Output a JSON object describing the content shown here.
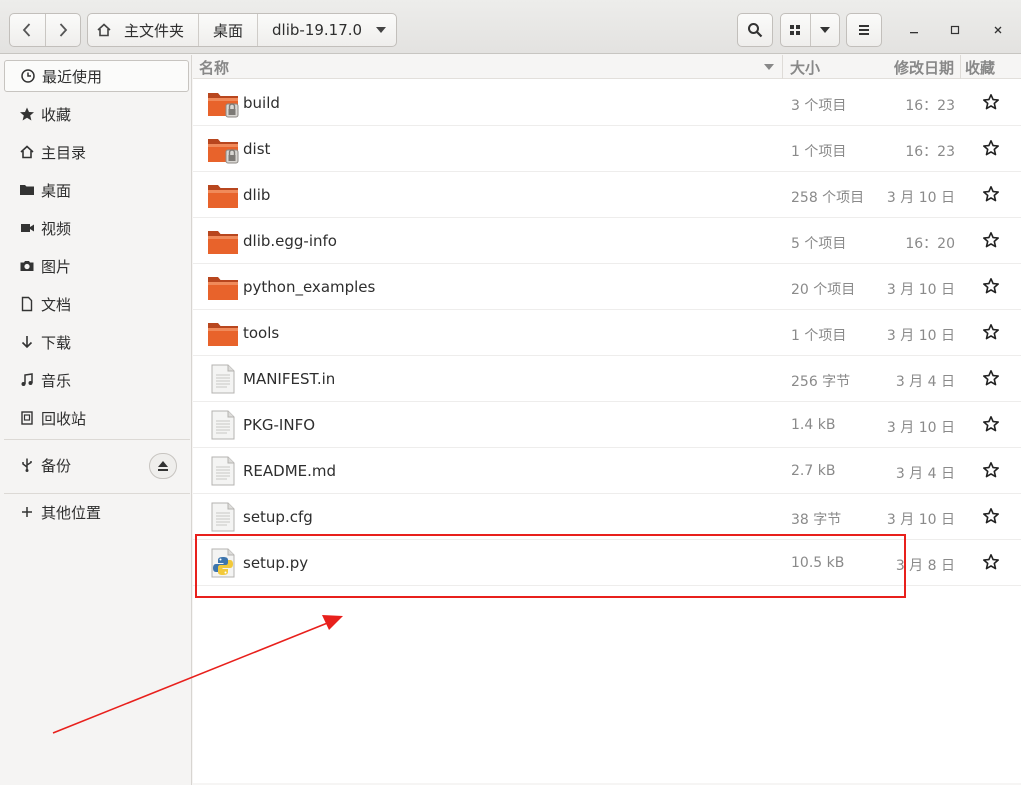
{
  "header": {
    "path": [
      "主文件夹",
      "桌面",
      "dlib-19.17.0"
    ]
  },
  "sidebar": {
    "items": [
      {
        "label": "最近使用",
        "icon": "clock-icon"
      },
      {
        "label": "收藏",
        "icon": "star-icon"
      },
      {
        "label": "主目录",
        "icon": "home-icon"
      },
      {
        "label": "桌面",
        "icon": "folder-icon"
      },
      {
        "label": "视频",
        "icon": "video-icon"
      },
      {
        "label": "图片",
        "icon": "camera-icon"
      },
      {
        "label": "文档",
        "icon": "document-icon"
      },
      {
        "label": "下载",
        "icon": "download-icon"
      },
      {
        "label": "音乐",
        "icon": "music-icon"
      },
      {
        "label": "回收站",
        "icon": "trash-icon"
      },
      {
        "label": "备份",
        "icon": "usb-icon"
      },
      {
        "label": "其他位置",
        "icon": "plus-icon"
      }
    ]
  },
  "columns": {
    "name": "名称",
    "size": "大小",
    "modified": "修改日期",
    "starred": "收藏"
  },
  "files": [
    {
      "name": "build",
      "size": "3 个项目",
      "date": "16：23",
      "type": "folder-locked"
    },
    {
      "name": "dist",
      "size": "1 个项目",
      "date": "16：23",
      "type": "folder-locked"
    },
    {
      "name": "dlib",
      "size": "258 个项目",
      "date": "3 月 10 日",
      "type": "folder"
    },
    {
      "name": "dlib.egg-info",
      "size": "5 个项目",
      "date": "16：20",
      "type": "folder"
    },
    {
      "name": "python_examples",
      "size": "20 个项目",
      "date": "3 月 10 日",
      "type": "folder"
    },
    {
      "name": "tools",
      "size": "1 个项目",
      "date": "3 月 10 日",
      "type": "folder"
    },
    {
      "name": "MANIFEST.in",
      "size": "256 字节",
      "date": "3 月 4 日",
      "type": "text"
    },
    {
      "name": "PKG-INFO",
      "size": "1.4 kB",
      "date": "3 月 10 日",
      "type": "text"
    },
    {
      "name": "README.md",
      "size": "2.7 kB",
      "date": "3 月 4 日",
      "type": "text"
    },
    {
      "name": "setup.cfg",
      "size": "38 字节",
      "date": "3 月 10 日",
      "type": "text"
    },
    {
      "name": "setup.py",
      "size": "10.5 kB",
      "date": "3 月 8 日",
      "type": "python"
    }
  ],
  "colors": {
    "folder": "#e8632b",
    "annotation": "#e8201c"
  }
}
